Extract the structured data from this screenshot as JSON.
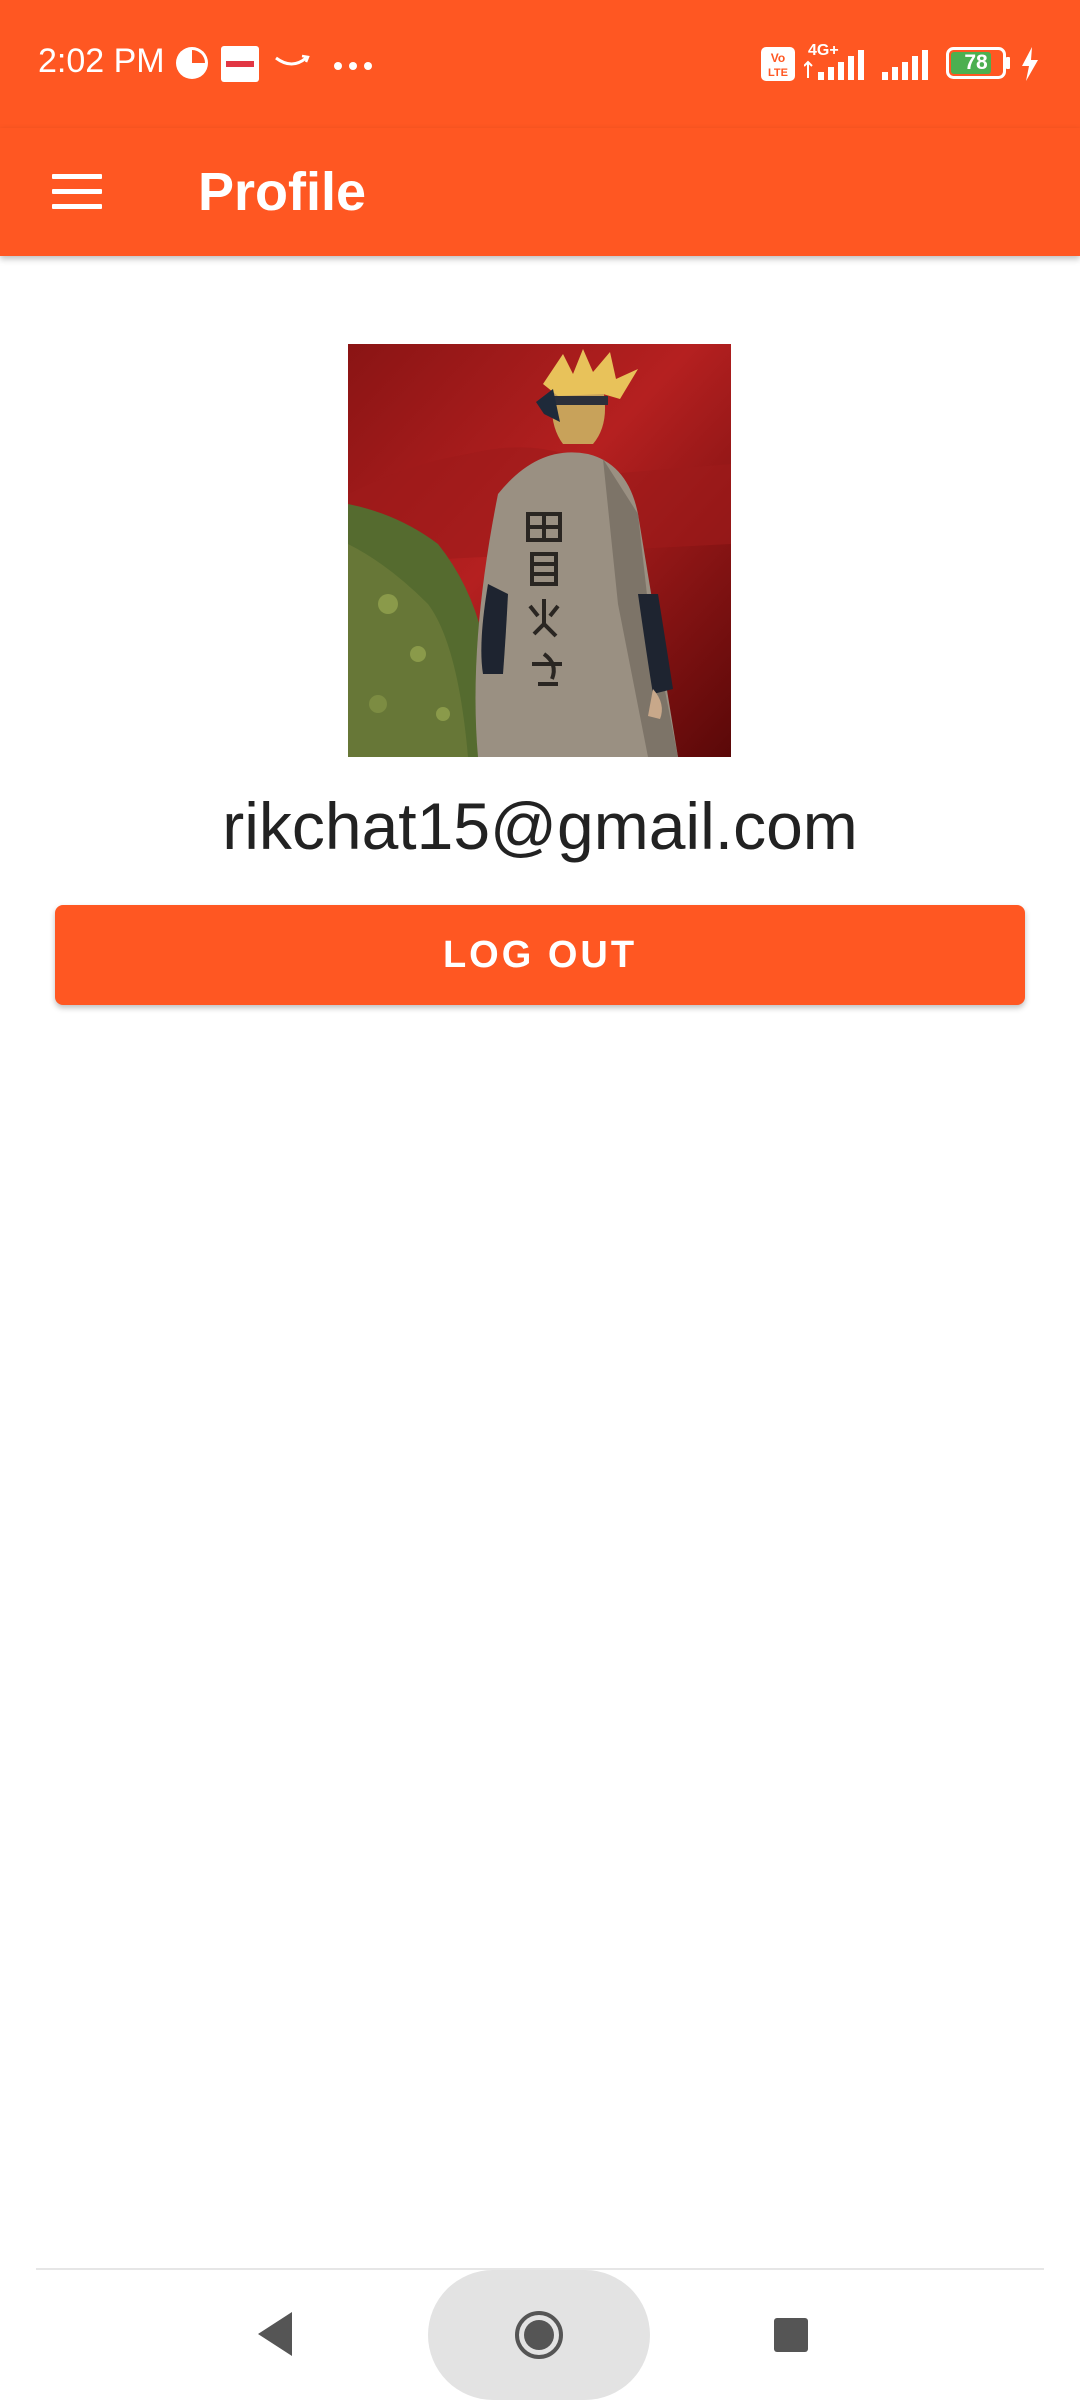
{
  "status_bar": {
    "time": "2:02 PM",
    "network_type": "4G+",
    "volte": "Vo LTE",
    "battery_level": "78",
    "icons": [
      "pie-chart-icon",
      "zomato-icon",
      "amazon-icon",
      "more-dots-icon",
      "volte-icon",
      "signal-icon",
      "battery-icon",
      "charging-icon"
    ]
  },
  "app_bar": {
    "title": "Profile",
    "menu_icon": "hamburger-menu-icon"
  },
  "profile": {
    "email": "rikchat15@gmail.com",
    "logout_label": "LOG OUT"
  },
  "colors": {
    "accent": "#ff5722",
    "text": "#222222",
    "background": "#ffffff"
  },
  "nav_bar": {
    "icons": [
      "back-icon",
      "home-icon",
      "recent-apps-icon"
    ]
  }
}
